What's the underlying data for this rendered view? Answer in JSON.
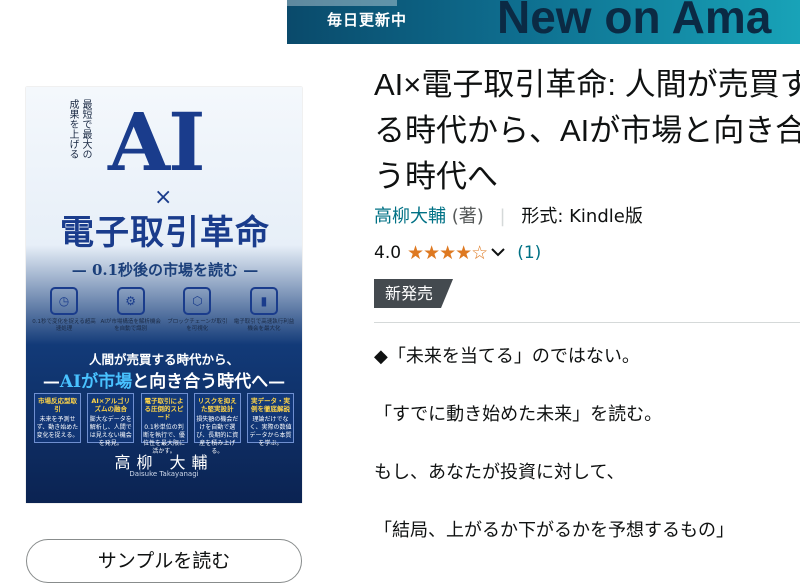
{
  "banner": {
    "small_text": "毎日更新中",
    "big_text": "New on Ama"
  },
  "cover": {
    "vertical_text": "最短で最大の成果を上げる",
    "ai": "AI",
    "times": "×",
    "main_title": "電子取引革命",
    "subtitle": "— 0.1秒後の市場を読む —",
    "features": [
      {
        "icon": "stopwatch-icon",
        "glyph": "◷",
        "text": "0.1秒で変化を捉える超高速処理"
      },
      {
        "icon": "chart-icon",
        "glyph": "⚙",
        "text": "AIが市場構造を解析機会を自動で識別"
      },
      {
        "icon": "blockchain-icon",
        "glyph": "⬡",
        "text": "ブロックチェーンが取引を可視化"
      },
      {
        "icon": "bar-chart-icon",
        "glyph": "▮",
        "text": "電子取引で高速執行利益機会を最大化"
      }
    ],
    "band_line1": "人間が売買する時代から、",
    "band_line2_pre": "—",
    "band_line2_hl": "AIが市場",
    "band_line2_post": "と向き合う時代へ—",
    "boxes": [
      {
        "head": "市場反応型取引",
        "body": "未来を予測せず、動き始めた変化を捉える。"
      },
      {
        "head": "AI×アルゴリズムの融合",
        "body": "膨大なデータを解析し、人間では見えない機会を発見。"
      },
      {
        "head": "電子取引による圧倒的スピード",
        "body": "0.1秒単位の判断を執行で、優位性を最大限に活かす。"
      },
      {
        "head": "リスクを抑えた堅実設計",
        "body": "損失額の機会だけを自動で選び、長期的に資産を積み上げる。"
      },
      {
        "head": "実データ・実例を徹底解説",
        "body": "理論だけでなく、実際の数値データから本質を学ぶ。"
      }
    ],
    "author_jp": "高柳 大輔",
    "author_en": "Daisuke Takayanagi"
  },
  "sample_button": "サンプルを読む",
  "product": {
    "title_lines": "AI×電子取引革命: 人間が売買す\nる時代から、AIが市場と向き合\nう時代へ",
    "author": "高柳大輔",
    "role": "(著)",
    "format_label": "形式: Kindle版",
    "rating_value": "4.0",
    "stars": "★★★★☆",
    "rating_count": "(1)",
    "badge": "新発売"
  },
  "description": [
    "◆「未来を当てる」のではない。",
    "「すでに動き始めた未来」を読む。",
    "もし、あなたが投資に対して、",
    "「結局、上がるか下がるかを予想するもの」"
  ],
  "colors": {
    "link": "#007185",
    "star": "#de7921",
    "badge_bg": "#444a4f",
    "cover_blue": "#1a3c8c"
  }
}
